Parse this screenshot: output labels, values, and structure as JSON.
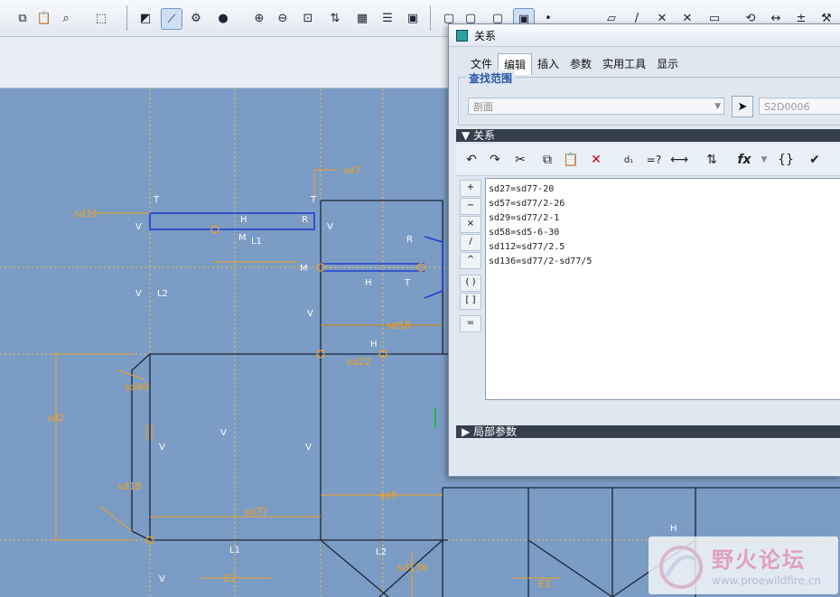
{
  "dialog": {
    "title": "关系",
    "menu": [
      "文件",
      "编辑",
      "插入",
      "参数",
      "实用工具",
      "显示"
    ],
    "active_menu": "编辑",
    "scope": {
      "title": "查找范围",
      "type_value": "剖面",
      "object_value": "S2D0006"
    },
    "relations_section": "关系",
    "local_params_section": "局部参数",
    "operators": [
      "+",
      "−",
      "×",
      "/",
      "^",
      "( )",
      "[ ]",
      "="
    ],
    "relations": [
      "sd27=sd77-20",
      "sd57=sd77/2-26",
      "sd29=sd77/2-1",
      "sd58=sd5-6-30",
      "sd112=sd77/2.5",
      "sd136=sd77/2-sd77/5"
    ],
    "fx_label": "fx"
  },
  "sketch_labels": [
    "sd7",
    "sd11",
    "sd40",
    "sd58",
    "sd2",
    "sd77",
    "sd5",
    "sd136",
    "sd22",
    "sd18",
    "E2",
    "L1",
    "L2",
    "H",
    "V",
    "T",
    "M",
    "R"
  ],
  "watermark": {
    "title": "野火论坛",
    "url": "www.proewildfire.cn"
  },
  "colors": {
    "canvas": "#7b9cc4",
    "dimension": "#f0a020",
    "geometry": "#1a2438",
    "selection": "#1f3fd0"
  }
}
